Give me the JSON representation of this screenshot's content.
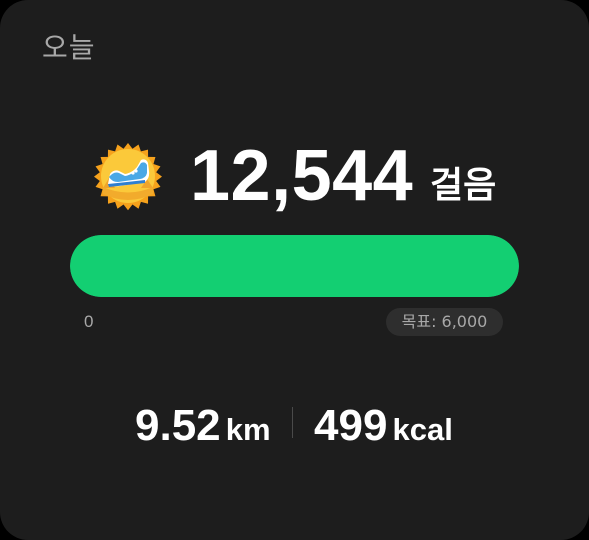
{
  "card": {
    "title": "오늘"
  },
  "steps": {
    "count": "12,544",
    "unit": "걸음",
    "badge_icon": "sneaker-badge-icon"
  },
  "progress": {
    "percent": 100,
    "min_label": "0",
    "goal_label": "목표: 6,000",
    "fill_color": "#13cf72"
  },
  "metrics": {
    "distance_value": "9.52",
    "distance_unit": "km",
    "calories_value": "499",
    "calories_unit": "kcal"
  }
}
